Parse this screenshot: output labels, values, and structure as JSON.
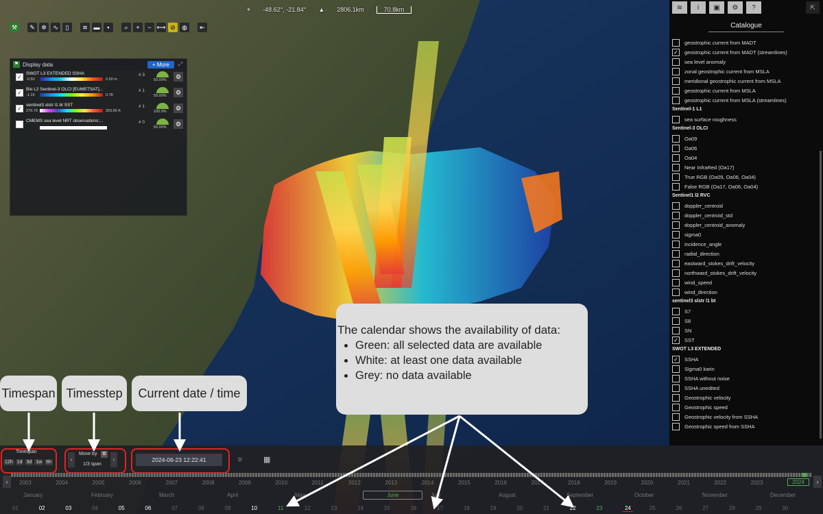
{
  "readout": {
    "coordinates": "-48.62°, -21.84°",
    "altitude": "2806.1km",
    "scale": "70.8km"
  },
  "toolbar": {
    "icons": [
      "tools-icon",
      "pencil-icon",
      "gear-wheel-icon",
      "chart-icon",
      "page-icon",
      "layers-icon",
      "folder-icon",
      "save-icon",
      "magnifier-icon",
      "zoom-in-icon",
      "zoom-out-icon",
      "ruler-icon",
      "compass-icon",
      "globe-icon",
      "collapse-icon"
    ]
  },
  "display_panel": {
    "title": "Display data",
    "more_label": "+ More",
    "layers": [
      {
        "name": "SWOT L3 EXTENDED SSHA",
        "min": "-0.50",
        "max": "0.50 m",
        "count": "# 3",
        "pct": "50.00%",
        "checked": "✓",
        "bar": "ssha"
      },
      {
        "name": "Bio L2 Sentinel-3 OLCI [EUMETSAT]...",
        "min": "-1.19",
        "max": "0.78",
        "count": "# 1",
        "pct": "50.00%",
        "checked": "✓",
        "bar": "olci"
      },
      {
        "name": "sentinel3 slstr l1 bt SST",
        "min": "279.79",
        "max": "303.65 K",
        "count": "# 1",
        "pct": "100.0%",
        "checked": "✓",
        "bar": "sst"
      },
      {
        "name": "CMEMS sea level NRT observations:...",
        "min": "",
        "max": "",
        "count": "# 0",
        "pct": "50.00%",
        "checked": "",
        "bar": "none"
      }
    ]
  },
  "right_panel": {
    "tabs": [
      "layers-tab-icon",
      "info-tab-icon",
      "monitor-tab-icon",
      "settings-tab-icon",
      "help-tab-icon"
    ],
    "tab_glyphs": [
      "≋",
      "i",
      "▣",
      "⚙",
      "?"
    ],
    "title": "Catalogue",
    "sections": [
      {
        "heading": "",
        "items": [
          {
            "label": "geostrophic current from MADT",
            "checked": ""
          },
          {
            "label": "geostrophic current from MADT (streamlines)",
            "checked": "✓"
          },
          {
            "label": "sea level anomaly",
            "checked": ""
          },
          {
            "label": "zonal geostrophic current from MSLA",
            "checked": ""
          },
          {
            "label": "meridional geostrophic current from MSLA",
            "checked": ""
          },
          {
            "label": "geostrophic current from MSLA",
            "checked": ""
          },
          {
            "label": "geostrophic current from MSLA (streamlines)",
            "checked": ""
          }
        ]
      },
      {
        "heading": "Sentinel-1 L1",
        "items": [
          {
            "label": "sea surface roughness",
            "checked": ""
          }
        ]
      },
      {
        "heading": "Sentinel-3 OLCI",
        "items": [
          {
            "label": "Oa09",
            "checked": ""
          },
          {
            "label": "Oa06",
            "checked": ""
          },
          {
            "label": "Oa04",
            "checked": ""
          },
          {
            "label": "Near InfraRed (Oa17)",
            "checked": ""
          },
          {
            "label": "True RGB (Oa09, Oa06, Oa04)",
            "checked": ""
          },
          {
            "label": "False RGB (Oa17, Oa06, Oa04)",
            "checked": ""
          }
        ]
      },
      {
        "heading": "Sentinel1 l2 RVC",
        "items": [
          {
            "label": "doppler_centroid",
            "checked": ""
          },
          {
            "label": "doppler_centroid_std",
            "checked": ""
          },
          {
            "label": "doppler_centroid_anomaly",
            "checked": ""
          },
          {
            "label": "sigma0",
            "checked": ""
          },
          {
            "label": "incidence_angle",
            "checked": ""
          },
          {
            "label": "radial_direction",
            "checked": ""
          },
          {
            "label": "eastward_stokes_drift_velocity",
            "checked": ""
          },
          {
            "label": "northward_stokes_drift_velocity",
            "checked": ""
          },
          {
            "label": "wind_speed",
            "checked": ""
          },
          {
            "label": "wind_direction",
            "checked": ""
          }
        ]
      },
      {
        "heading": "sentinel3 slstr l1 bt",
        "items": [
          {
            "label": "S7",
            "checked": ""
          },
          {
            "label": "S8",
            "checked": ""
          },
          {
            "label": "SN",
            "checked": ""
          },
          {
            "label": "SST",
            "checked": "✓"
          }
        ]
      },
      {
        "heading": "SWOT L3 EXTENDED",
        "items": [
          {
            "label": "SSHA",
            "checked": "✓"
          },
          {
            "label": "Sigma0 karin",
            "checked": ""
          },
          {
            "label": "SSHA without noise",
            "checked": ""
          },
          {
            "label": "SSHA unedited",
            "checked": ""
          },
          {
            "label": "Geostrophic velocity",
            "checked": ""
          },
          {
            "label": "Geostrophic speed",
            "checked": ""
          },
          {
            "label": "Geostrophic velocity from SSHA",
            "checked": ""
          },
          {
            "label": "Geostrophic speed from SSHA",
            "checked": ""
          }
        ]
      }
    ]
  },
  "callouts": {
    "timespan": "Timespan",
    "timestep": "Timesstep",
    "current_date": "Current date / time",
    "calendar_intro": "The calendar shows the availability of data:",
    "calendar_items": [
      "Green: all selected data are available",
      "White: at least one data available",
      "Grey: no data available"
    ]
  },
  "controls": {
    "timespan_label": "Timespan",
    "timespan_options": [
      "12h",
      "1d",
      "3d",
      "1w",
      "6h"
    ],
    "move_by_label": "Move by",
    "move_by_value": "1/3 span",
    "current_datetime": "2024-06-23 12:22:41",
    "prev_glyph": "‹",
    "next_glyph": "›"
  },
  "calendar": {
    "years": [
      "2003",
      "2004",
      "2005",
      "2006",
      "2007",
      "2008",
      "2009",
      "2010",
      "2011",
      "2012",
      "2013",
      "2014",
      "2015",
      "2016",
      "2017",
      "2018",
      "2019",
      "2020",
      "2021",
      "2022",
      "2023",
      "2024"
    ],
    "selected_year": "2024",
    "months": [
      "January",
      "February",
      "March",
      "April",
      "May",
      "June",
      "July",
      "August",
      "September",
      "October",
      "November",
      "December"
    ],
    "selected_month": "June",
    "days": [
      {
        "d": "01",
        "s": "g"
      },
      {
        "d": "02",
        "s": "w"
      },
      {
        "d": "03",
        "s": "w"
      },
      {
        "d": "04",
        "s": "g"
      },
      {
        "d": "05",
        "s": "w"
      },
      {
        "d": "06",
        "s": "w"
      },
      {
        "d": "07",
        "s": "g"
      },
      {
        "d": "08",
        "s": "g"
      },
      {
        "d": "09",
        "s": "g"
      },
      {
        "d": "10",
        "s": "w"
      },
      {
        "d": "11",
        "s": "gr"
      },
      {
        "d": "12",
        "s": "g"
      },
      {
        "d": "13",
        "s": "g"
      },
      {
        "d": "14",
        "s": "g"
      },
      {
        "d": "15",
        "s": "g"
      },
      {
        "d": "16",
        "s": "g"
      },
      {
        "d": "17",
        "s": "g"
      },
      {
        "d": "18",
        "s": "g"
      },
      {
        "d": "19",
        "s": "g"
      },
      {
        "d": "20",
        "s": "g"
      },
      {
        "d": "21",
        "s": "g"
      },
      {
        "d": "22",
        "s": "w"
      },
      {
        "d": "23",
        "s": "gr"
      },
      {
        "d": "24",
        "s": "sel"
      },
      {
        "d": "25",
        "s": "g"
      },
      {
        "d": "26",
        "s": "g"
      },
      {
        "d": "27",
        "s": "g"
      },
      {
        "d": "28",
        "s": "g"
      },
      {
        "d": "29",
        "s": "g"
      },
      {
        "d": "30",
        "s": "g"
      }
    ]
  },
  "colors": {
    "accent_green": "#4caf50",
    "callout_red": "#e02424",
    "callout_bg": "#dedede"
  }
}
